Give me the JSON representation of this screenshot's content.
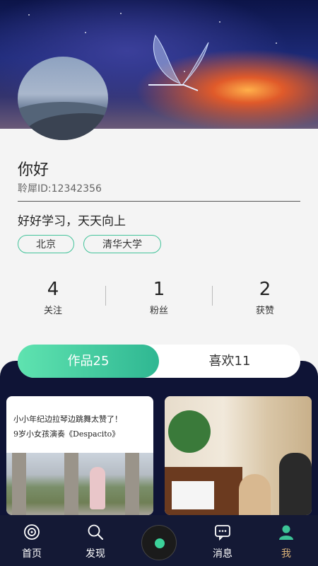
{
  "profile": {
    "name": "你好",
    "user_id": "聆犀ID:12342356",
    "bio": "好好学习，天天向上",
    "tags": [
      "北京",
      "清华大学"
    ]
  },
  "stats": [
    {
      "value": "4",
      "label": "关注"
    },
    {
      "value": "1",
      "label": "粉丝"
    },
    {
      "value": "2",
      "label": "获赞"
    }
  ],
  "tabs": {
    "works": "作品25",
    "likes": "喜欢11"
  },
  "cards": [
    {
      "caption_line1": "小小年纪边拉琴边跳舞太赞了！",
      "caption_line2": "9岁小女孩演奏《Despacito》"
    }
  ],
  "nav": [
    {
      "label": "首页",
      "icon": "home-disc-icon"
    },
    {
      "label": "发现",
      "icon": "search-icon"
    },
    {
      "label": "",
      "icon": "music-disc-icon"
    },
    {
      "label": "消息",
      "icon": "chat-bubble-icon"
    },
    {
      "label": "我",
      "icon": "user-icon"
    }
  ],
  "colors": {
    "accent": "#3cc497",
    "nav_bg": "#141935",
    "active_nav": "#d9b178"
  }
}
